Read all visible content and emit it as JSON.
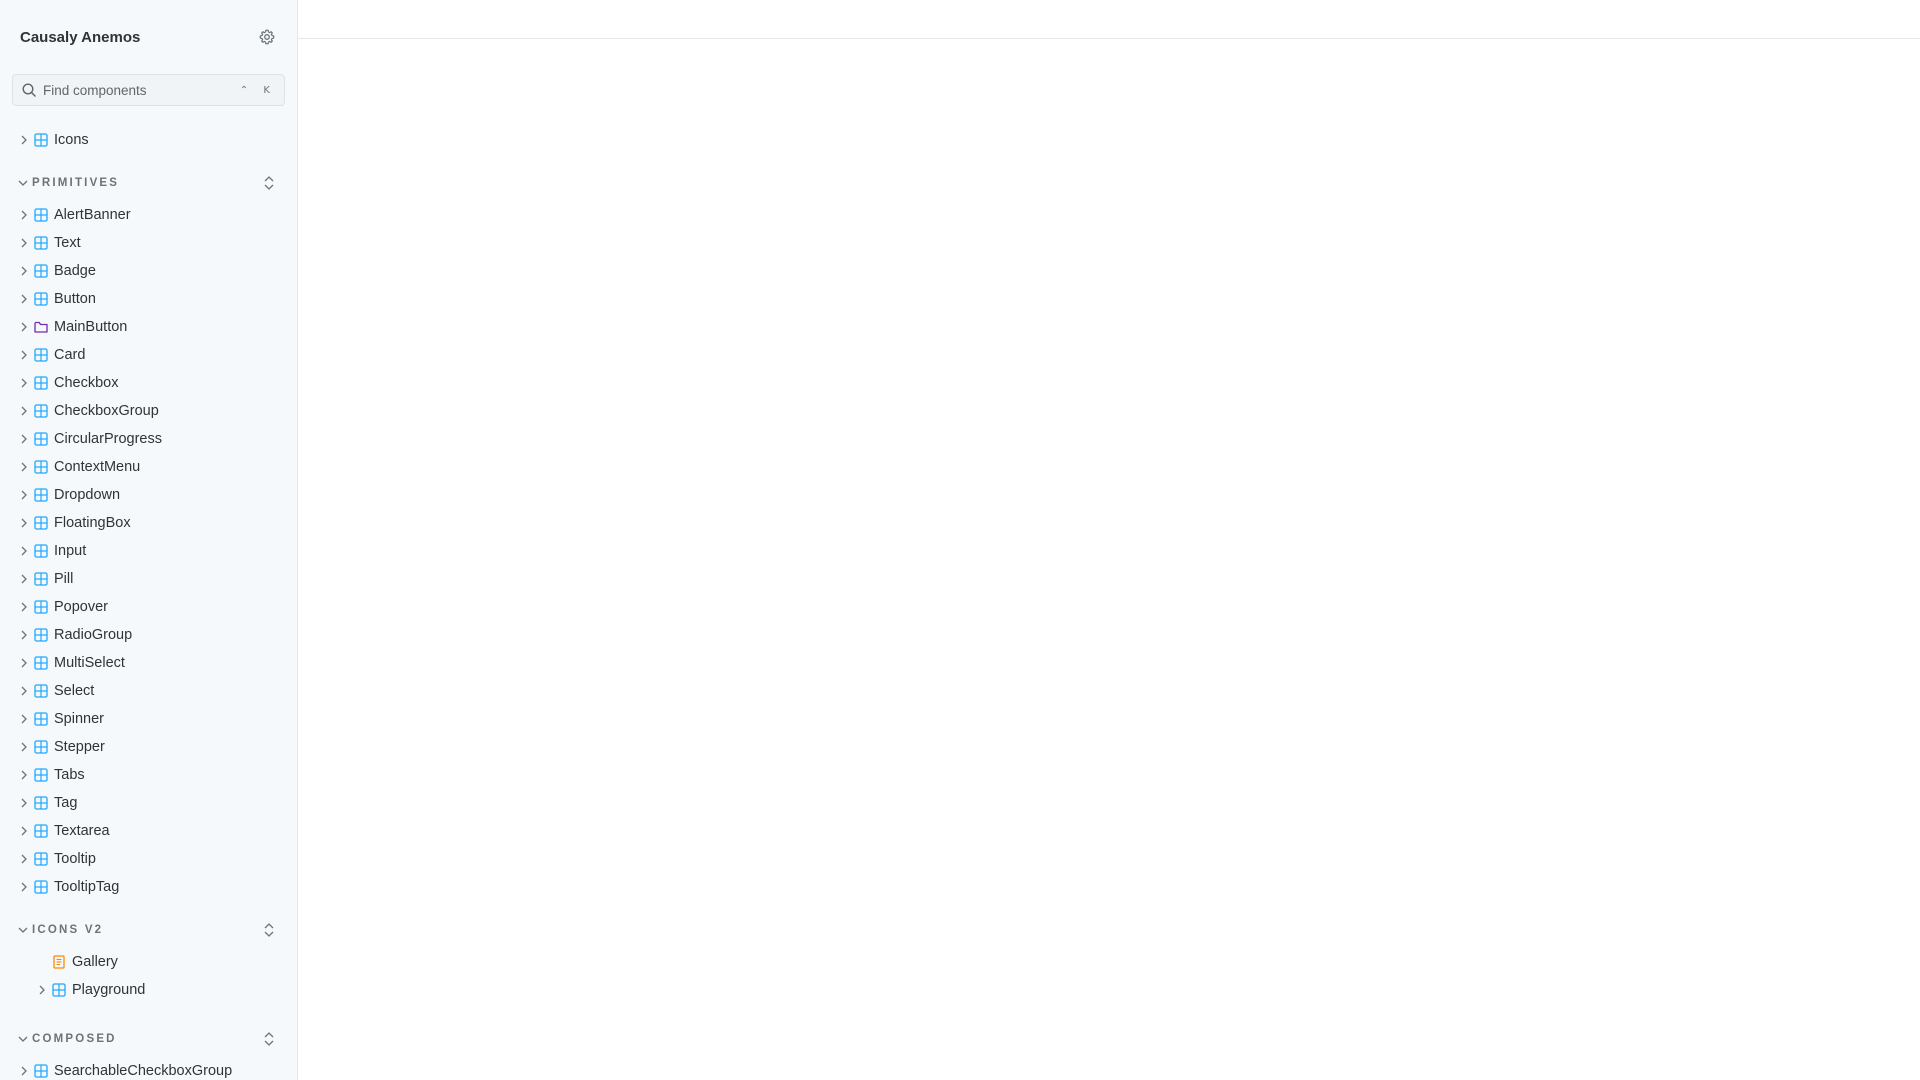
{
  "sidebar": {
    "title": "Causaly Anemos",
    "search": {
      "placeholder": "Find components",
      "shortcut": "⌃ K"
    },
    "top_items": [
      {
        "label": "Icons",
        "kind": "component"
      }
    ],
    "sections": {
      "primitives": {
        "label": "PRIMITIVES",
        "items": [
          {
            "label": "AlertBanner",
            "kind": "component"
          },
          {
            "label": "Text",
            "kind": "component"
          },
          {
            "label": "Badge",
            "kind": "component"
          },
          {
            "label": "Button",
            "kind": "component"
          },
          {
            "label": "MainButton",
            "kind": "folder"
          },
          {
            "label": "Card",
            "kind": "component"
          },
          {
            "label": "Checkbox",
            "kind": "component"
          },
          {
            "label": "CheckboxGroup",
            "kind": "component"
          },
          {
            "label": "CircularProgress",
            "kind": "component"
          },
          {
            "label": "ContextMenu",
            "kind": "component"
          },
          {
            "label": "Dropdown",
            "kind": "component"
          },
          {
            "label": "FloatingBox",
            "kind": "component"
          },
          {
            "label": "Input",
            "kind": "component"
          },
          {
            "label": "Pill",
            "kind": "component"
          },
          {
            "label": "Popover",
            "kind": "component"
          },
          {
            "label": "RadioGroup",
            "kind": "component"
          },
          {
            "label": "MultiSelect",
            "kind": "component"
          },
          {
            "label": "Select",
            "kind": "component"
          },
          {
            "label": "Spinner",
            "kind": "component"
          },
          {
            "label": "Stepper",
            "kind": "component"
          },
          {
            "label": "Tabs",
            "kind": "component"
          },
          {
            "label": "Tag",
            "kind": "component"
          },
          {
            "label": "Textarea",
            "kind": "component"
          },
          {
            "label": "Tooltip",
            "kind": "component"
          },
          {
            "label": "TooltipTag",
            "kind": "component"
          }
        ]
      },
      "icons_v2": {
        "label": "ICONS V2",
        "items": [
          {
            "label": "Gallery",
            "kind": "document"
          },
          {
            "label": "Playground",
            "kind": "component"
          }
        ]
      },
      "composed": {
        "label": "COMPOSED",
        "items": [
          {
            "label": "SearchableCheckboxGroup",
            "kind": "component"
          }
        ]
      }
    }
  },
  "colors": {
    "component_icon": "#1ea7fd",
    "folder_icon": "#6f2cac",
    "document_icon": "#ff8500",
    "sidebar_bg": "#f6f9fc"
  },
  "icons": {
    "settings": "gear-icon",
    "search": "search-icon",
    "chevron": "chevron-right-icon",
    "expand": "expand-collapse-icon"
  }
}
